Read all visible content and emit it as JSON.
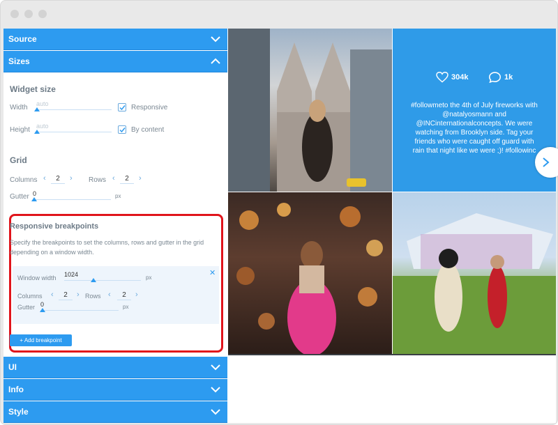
{
  "sidebar": {
    "sections": {
      "source": "Source",
      "sizes": "Sizes",
      "ui": "UI",
      "info": "Info",
      "style": "Style"
    },
    "widget_size": {
      "title": "Widget size",
      "width_label": "Width",
      "width_placeholder": "auto",
      "responsive_label": "Responsive",
      "height_label": "Height",
      "height_placeholder": "auto",
      "by_content_label": "By content"
    },
    "grid": {
      "title": "Grid",
      "columns_label": "Columns",
      "columns_value": "2",
      "rows_label": "Rows",
      "rows_value": "2",
      "gutter_label": "Gutter",
      "gutter_value": "0",
      "gutter_unit": "px"
    },
    "breakpoints": {
      "title": "Responsive breakpoints",
      "description": "Specify the breakpoints to set the columns, rows and gutter in the grid depending on a window width.",
      "window_width_label": "Window width",
      "window_width_value": "1024",
      "window_width_unit": "px",
      "columns_label": "Columns",
      "columns_value": "2",
      "rows_label": "Rows",
      "rows_value": "2",
      "gutter_label": "Gutter",
      "gutter_value": "0",
      "gutter_unit": "px",
      "add_button": "+ Add breakpoint"
    }
  },
  "feed": {
    "likes": "304k",
    "comments": "1k",
    "caption": "#followmeto the 4th of July fireworks with @natalyosmann and @INCinternationalconcepts. We were watching from Brooklyn side. Tag your friends who were caught off guard with rain that night like we were ;)! #followinc"
  },
  "colors": {
    "accent": "#2d9bf0",
    "highlight": "#e0141b"
  }
}
